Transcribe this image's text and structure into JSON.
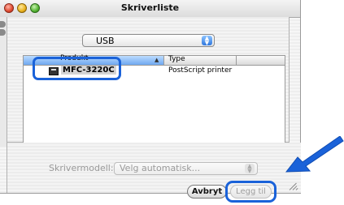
{
  "window": {
    "title": "Skriverliste"
  },
  "connection_popup": {
    "value": "USB"
  },
  "table": {
    "columns": [
      "Produkt",
      "Type"
    ],
    "rows": [
      {
        "product": "MFC-3220C",
        "type": "PostScript printer"
      }
    ]
  },
  "printer_model": {
    "label": "Skrivermodell:",
    "value": "Velg automatisk..."
  },
  "buttons": {
    "cancel": "Avbryt",
    "add": "Legg til"
  },
  "colors": {
    "annotation": "#1a62d9",
    "selection_header": "#6ea8f0"
  },
  "icons": [
    "close-icon",
    "minimize-icon",
    "zoom-icon",
    "popup-arrows-icon",
    "sort-ascending-icon",
    "printer-icon",
    "resize-grip-icon",
    "annotation-arrow-icon"
  ]
}
